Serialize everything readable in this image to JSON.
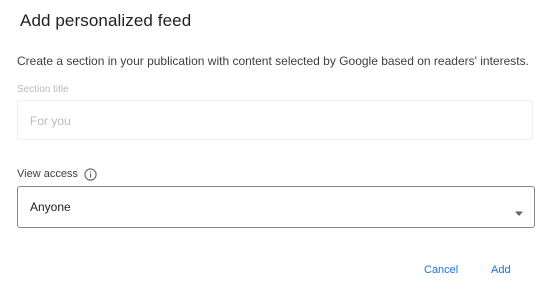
{
  "dialog": {
    "title": "Add personalized feed",
    "description": "Create a section in your publication with content selected by Google based on readers' interests.",
    "section_title": {
      "label": "Section title",
      "placeholder": "For you",
      "value": ""
    },
    "view_access": {
      "label": "View access",
      "info_icon": "info-icon",
      "selected": "Anyone",
      "dropdown_icon": "arrow-drop-down-icon"
    },
    "actions": {
      "cancel_label": "Cancel",
      "add_label": "Add"
    }
  },
  "colors": {
    "accent": "#1a73e8",
    "text_primary": "#202124",
    "text_muted": "#b7bbbf",
    "border": "#80868b"
  }
}
